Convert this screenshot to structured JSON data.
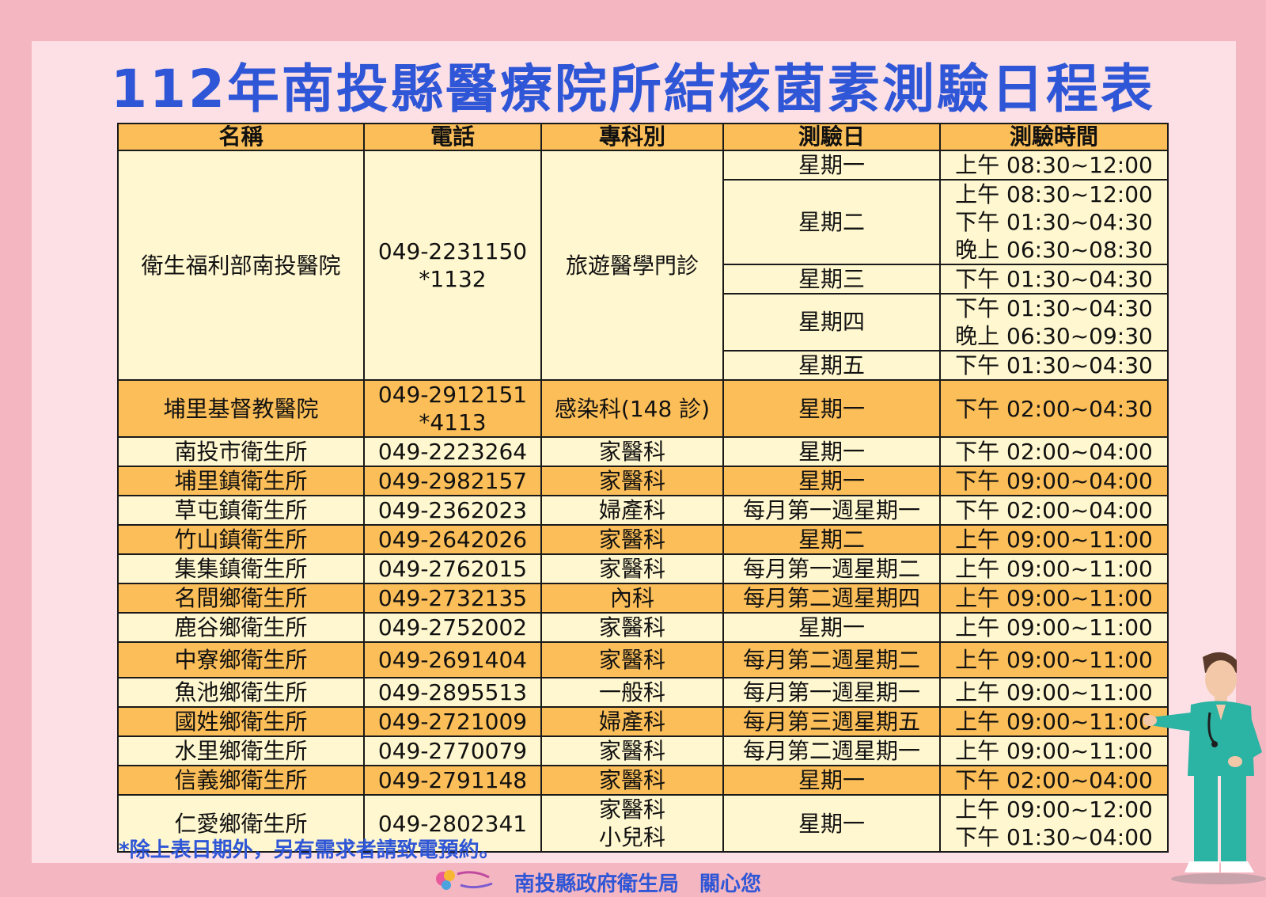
{
  "title": "112年南投縣醫療院所結核菌素測驗日程表",
  "headers": [
    "名稱",
    "電話",
    "專科別",
    "測驗日",
    "測驗時間"
  ],
  "hospital1": {
    "name": "衛生福利部南投醫院",
    "phone1": "049-2231150",
    "phone2": "*1132",
    "dept": "旅遊醫學門診",
    "schedule": [
      {
        "day": "星期一",
        "times": [
          "上午 08:30~12:00"
        ]
      },
      {
        "day": "星期二",
        "times": [
          "上午 08:30~12:00",
          "下午 01:30~04:30",
          "晚上 06:30~08:30"
        ]
      },
      {
        "day": "星期三",
        "times": [
          "下午 01:30~04:30"
        ]
      },
      {
        "day": "星期四",
        "times": [
          "下午 01:30~04:30",
          "晚上 06:30~09:30"
        ]
      },
      {
        "day": "星期五",
        "times": [
          "下午 01:30~04:30"
        ]
      }
    ]
  },
  "hospital2": {
    "name": "埔里基督教醫院",
    "phone1": "049-2912151",
    "phone2": "*4113",
    "dept": "感染科(148 診)",
    "day": "星期一",
    "time": "下午 02:00~04:30"
  },
  "rows": [
    {
      "name": "南投市衛生所",
      "phone": "049-2223264",
      "dept": "家醫科",
      "day": "星期一",
      "time": "下午 02:00~04:00"
    },
    {
      "name": "埔里鎮衛生所",
      "phone": "049-2982157",
      "dept": "家醫科",
      "day": "星期一",
      "time": "下午 09:00~04:00"
    },
    {
      "name": "草屯鎮衛生所",
      "phone": "049-2362023",
      "dept": "婦產科",
      "day": "每月第一週星期一",
      "time": "下午 02:00~04:00"
    },
    {
      "name": "竹山鎮衛生所",
      "phone": "049-2642026",
      "dept": "家醫科",
      "day": "星期二",
      "time": "上午 09:00~11:00"
    },
    {
      "name": "集集鎮衛生所",
      "phone": "049-2762015",
      "dept": "家醫科",
      "day": "每月第一週星期二",
      "time": "上午 09:00~11:00"
    },
    {
      "name": "名間鄉衛生所",
      "phone": "049-2732135",
      "dept": "內科",
      "day": "每月第二週星期四",
      "time": "上午 09:00~11:00"
    },
    {
      "name": "鹿谷鄉衛生所",
      "phone": "049-2752002",
      "dept": "家醫科",
      "day": "星期一",
      "time": "上午 09:00~11:00"
    },
    {
      "name": "中寮鄉衛生所",
      "phone": "049-2691404",
      "dept": "家醫科",
      "day": "每月第二週星期二",
      "time": "上午 09:00~11:00"
    },
    {
      "name": "魚池鄉衛生所",
      "phone": "049-2895513",
      "dept": "一般科",
      "day": "每月第一週星期一",
      "time": "上午 09:00~11:00"
    },
    {
      "name": "國姓鄉衛生所",
      "phone": "049-2721009",
      "dept": "婦產科",
      "day": "每月第三週星期五",
      "time": "上午 09:00~11:00"
    },
    {
      "name": "水里鄉衛生所",
      "phone": "049-2770079",
      "dept": "家醫科",
      "day": "每月第二週星期一",
      "time": "上午 09:00~11:00"
    },
    {
      "name": "信義鄉衛生所",
      "phone": "049-2791148",
      "dept": "家醫科",
      "day": "星期一",
      "time": "下午 02:00~04:00"
    }
  ],
  "last": {
    "name": "仁愛鄉衛生所",
    "phone": "049-2802341",
    "dept1": "家醫科",
    "dept2": "小兒科",
    "day": "星期一",
    "time1": "上午 09:00~12:00",
    "time2": "下午 01:30~04:00"
  },
  "note": "*除上表日期外，另有需求者請致電預約。",
  "footer": "南投縣政府衛生局　關心您",
  "colors": {
    "title": "#2f56d6",
    "header": "#fbbe58",
    "row_light": "#fff7cf",
    "background": "#f4b6c0"
  }
}
